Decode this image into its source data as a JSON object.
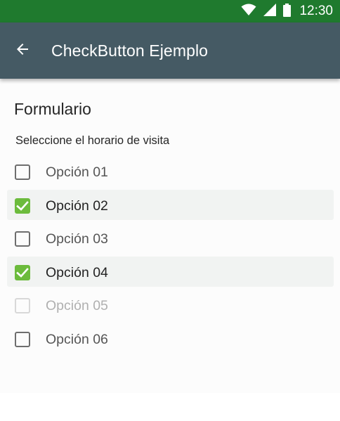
{
  "status_bar": {
    "time": "12:30",
    "color": "#1f7a2e",
    "icons": [
      "wifi-icon",
      "cell-signal-icon",
      "battery-icon"
    ]
  },
  "app_bar": {
    "title": "CheckButton Ejemplo",
    "back_icon": "arrow-left-icon",
    "color": "#455a64"
  },
  "form": {
    "title": "Formulario",
    "subtitle": "Seleccione el horario de visita",
    "accent_color": "#6cbb3c",
    "options": [
      {
        "label": "Opción 01",
        "checked": false,
        "enabled": true
      },
      {
        "label": "Opción 02",
        "checked": true,
        "enabled": true
      },
      {
        "label": "Opción 03",
        "checked": false,
        "enabled": true
      },
      {
        "label": "Opción 04",
        "checked": true,
        "enabled": true
      },
      {
        "label": "Opción 05",
        "checked": false,
        "enabled": false
      },
      {
        "label": "Opción 06",
        "checked": false,
        "enabled": true
      }
    ]
  }
}
